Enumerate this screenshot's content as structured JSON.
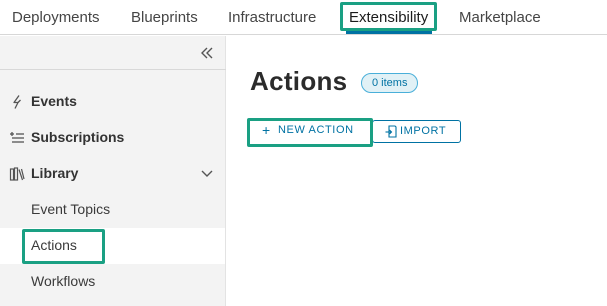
{
  "topnav": {
    "tabs": [
      {
        "label": "Deployments"
      },
      {
        "label": "Blueprints"
      },
      {
        "label": "Infrastructure"
      },
      {
        "label": "Extensibility",
        "active": true
      },
      {
        "label": "Marketplace"
      }
    ]
  },
  "sidebar": {
    "collapse_icon": "double-chevron-left-icon",
    "items": [
      {
        "label": "Events",
        "icon": "lightning-icon"
      },
      {
        "label": "Subscriptions",
        "icon": "list-icon"
      },
      {
        "label": "Library",
        "icon": "library-icon",
        "expanded": true
      }
    ],
    "library_children": [
      {
        "label": "Event Topics"
      },
      {
        "label": "Actions",
        "selected": true
      },
      {
        "label": "Workflows"
      }
    ]
  },
  "main": {
    "title": "Actions",
    "count_badge": "0 items",
    "new_action_label": "NEW ACTION",
    "import_label": "IMPORT"
  },
  "colors": {
    "accent": "#0072a3",
    "highlight": "#1aa083",
    "sidebar_bg": "#f3f3f3",
    "badge_bg": "#e1f1f6"
  }
}
